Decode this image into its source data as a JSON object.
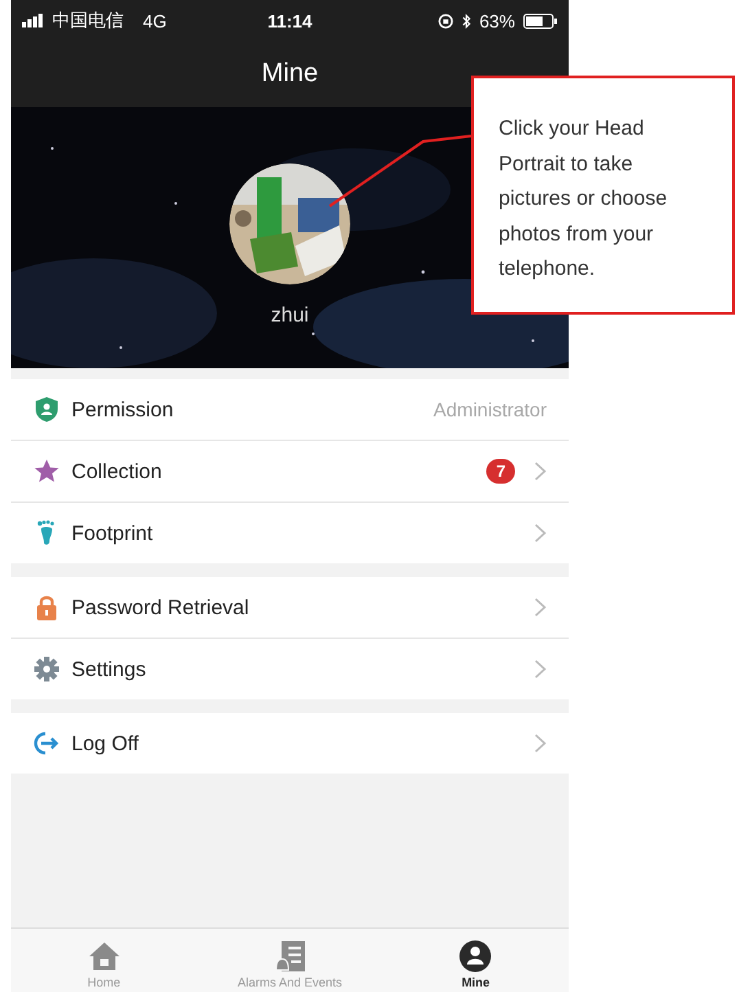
{
  "status_bar": {
    "carrier": "中国电信",
    "network": "4G",
    "time": "11:14",
    "battery": "63%"
  },
  "nav_bar": {
    "title": "Mine"
  },
  "profile": {
    "username": "zhui"
  },
  "callout": {
    "text": "Click your Head Portrait to take pictures or choose photos from your telephone."
  },
  "menu_sections": [
    {
      "items": [
        {
          "kind": "shield",
          "label": "Permission",
          "value": "Administrator",
          "chevron": false
        },
        {
          "kind": "star",
          "label": "Collection",
          "badge": "7",
          "chevron": true
        },
        {
          "kind": "footprint",
          "label": "Footprint",
          "chevron": true
        }
      ]
    },
    {
      "items": [
        {
          "kind": "lock",
          "label": "Password Retrieval",
          "chevron": true
        },
        {
          "kind": "gear",
          "label": "Settings",
          "chevron": true
        }
      ]
    },
    {
      "items": [
        {
          "kind": "logout",
          "label": "Log Off",
          "chevron": true
        }
      ]
    }
  ],
  "tab_bar": [
    {
      "kind": "home",
      "label": "Home",
      "selected": false
    },
    {
      "kind": "alarms",
      "label": "Alarms And Events",
      "selected": false
    },
    {
      "kind": "person",
      "label": "Mine",
      "selected": true
    }
  ]
}
